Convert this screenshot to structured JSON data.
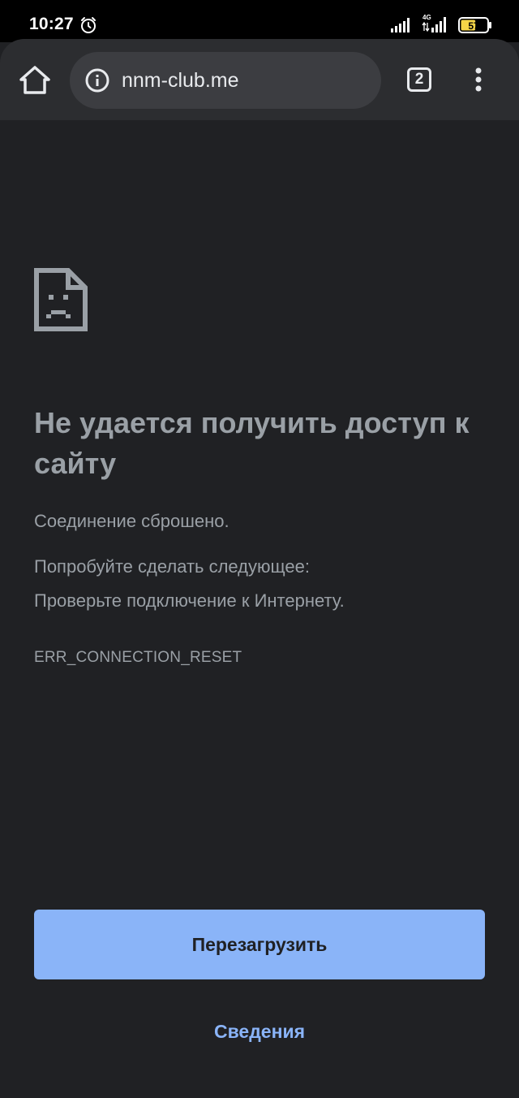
{
  "status_bar": {
    "time": "10:27",
    "network_label": "4G",
    "battery_level": "57",
    "battery_color": "#f5d547"
  },
  "toolbar": {
    "url": "nnm-club.me",
    "tab_count": "2"
  },
  "error_page": {
    "title": "Не удается получить доступ к сайту",
    "description": "Соединение сброшено.",
    "suggestion_heading": "Попробуйте сделать следующее:",
    "suggestion_item": "Проверьте подключение к Интернету.",
    "error_code": "ERR_CONNECTION_RESET",
    "reload_label": "Перезагрузить",
    "details_label": "Сведения"
  },
  "colors": {
    "background": "#202124",
    "toolbar": "#2c2d30",
    "omnibox": "#3c3d41",
    "text_secondary": "#9aa0a6",
    "accent": "#8ab4f8"
  }
}
